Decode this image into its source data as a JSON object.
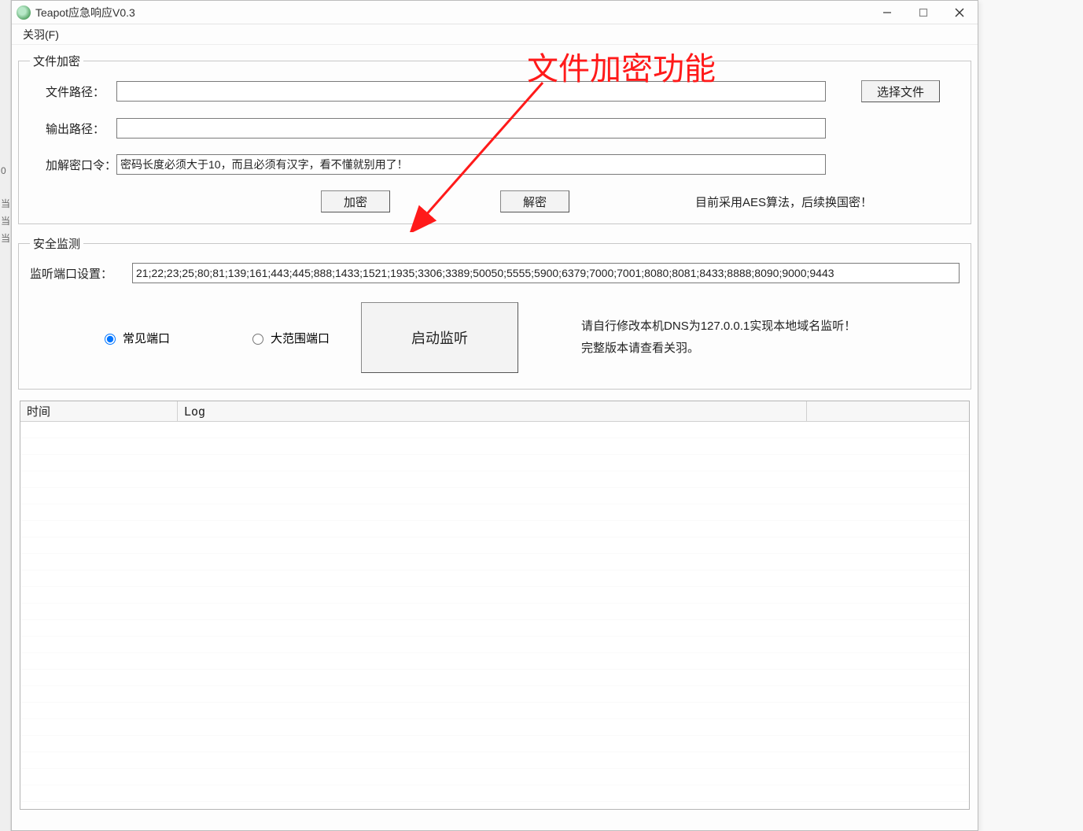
{
  "window": {
    "title": "Teapot应急响应V0.3"
  },
  "menubar": {
    "item1": "关羽(F)"
  },
  "group_encrypt": {
    "legend": "文件加密",
    "file_path_label": "文件路径：",
    "file_path_value": "",
    "output_path_label": "输出路径：",
    "output_path_value": "",
    "password_label": "加解密口令：",
    "password_value": "密码长度必须大于10，而且必须有汉字，看不懂就别用了！",
    "select_file_btn": "选择文件",
    "encrypt_btn": "加密",
    "decrypt_btn": "解密",
    "algo_note": "目前采用AES算法，后续换国密！"
  },
  "group_monitor": {
    "legend": "安全监测",
    "port_label": "监听端口设置：",
    "port_value": "21;22;23;25;80;81;139;161;443;445;888;1433;1521;1935;3306;3389;50050;5555;5900;6379;7000;7001;8080;8081;8433;8888;8090;9000;9443",
    "radio_common": "常见端口",
    "radio_wide": "大范围端口",
    "start_btn": "启动监听",
    "dns_note_line1": "请自行修改本机DNS为127.0.0.1实现本地域名监听！",
    "dns_note_line2": "完整版本请查看关羽。"
  },
  "listview": {
    "col_time": "时间",
    "col_log": "Log"
  },
  "annotation": {
    "text": "文件加密功能"
  }
}
